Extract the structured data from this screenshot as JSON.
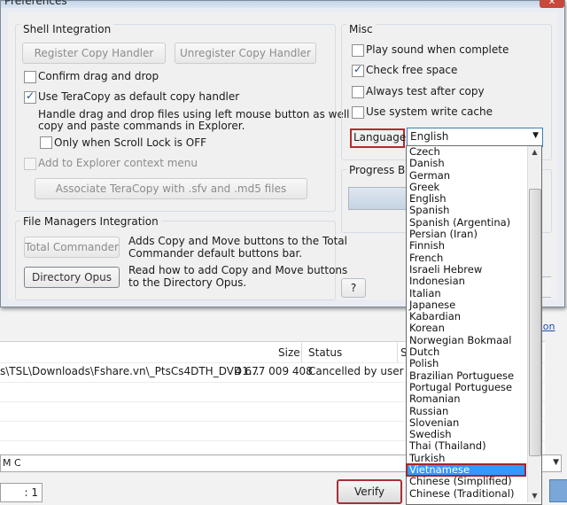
{
  "window": {
    "title": "Preferences",
    "close_glyph": "✕"
  },
  "shell": {
    "title": "Shell Integration",
    "register_btn": "Register Copy Handler",
    "unregister_btn": "Unregister Copy Handler",
    "confirm_drag": {
      "label": "Confirm drag and drop",
      "checked": false
    },
    "use_default": {
      "label": "Use TeraCopy as default copy handler",
      "checked": true
    },
    "desc_line1": "Handle drag and drop files using left mouse button as well as",
    "desc_line2": "copy and paste commands in Explorer.",
    "scroll_lock": {
      "label": "Only when Scroll Lock is OFF",
      "checked": false
    },
    "explorer_menu": {
      "label": "Add to Explorer context menu",
      "checked": false
    },
    "associate_btn": "Associate TeraCopy with .sfv and .md5 files"
  },
  "fm": {
    "title": "File Managers Integration",
    "total_btn": "Total Commander",
    "total_desc1": "Adds Copy and Move buttons to the Total",
    "total_desc2": "Commander default buttons bar.",
    "opus_btn": "Directory Opus",
    "opus_desc1": "Read how to add Copy and Move buttons",
    "opus_desc2": "to the Directory Opus."
  },
  "misc": {
    "title": "Misc",
    "play_sound": {
      "label": "Play sound when complete",
      "checked": false
    },
    "check_free": {
      "label": "Check free space",
      "checked": true
    },
    "always_test": {
      "label": "Always test after copy",
      "checked": false
    },
    "write_cache": {
      "label": "Use system write cache",
      "checked": false
    },
    "language_label": "Language:",
    "language_value": "English"
  },
  "progress": {
    "title": "Progress Bar"
  },
  "help_btn": "?",
  "languages": [
    "Czech",
    "Danish",
    "German",
    "Greek",
    "English",
    "Spanish",
    "Spanish (Argentina)",
    "Persian (Iran)",
    "Finnish",
    "French",
    "Israeli Hebrew",
    "Indonesian",
    "Italian",
    "Japanese",
    "Kabardian",
    "Korean",
    "Norwegian Bokmaal",
    "Dutch",
    "Polish",
    "Brazilian Portuguese",
    "Portugal Portuguese",
    "Romanian",
    "Russian",
    "Slovenian",
    "Swedish",
    "Thai (Thailand)",
    "Turkish",
    "Vietnamese",
    "Chinese (Simplified)",
    "Chinese (Traditional)"
  ],
  "selected_language": "Vietnamese",
  "main": {
    "col_size": "Size",
    "col_status": "Status",
    "col_extra": "S",
    "row_path": "s\\TSL\\Downloads\\Fshare.vn\\_PtsCs4DTH_DVD1...",
    "row_size": "4 677 009 408",
    "row_status": "Cancelled by user",
    "link_partial": "sion",
    "status_partial": "M C",
    "page_value": ": 1",
    "verify_btn": "Verify"
  },
  "icons": {
    "check": "✓",
    "arrow_down": "▼",
    "arrow_up": "▲"
  },
  "colors": {
    "selection": "#3399ff",
    "highlight_border": "#b02c34"
  }
}
